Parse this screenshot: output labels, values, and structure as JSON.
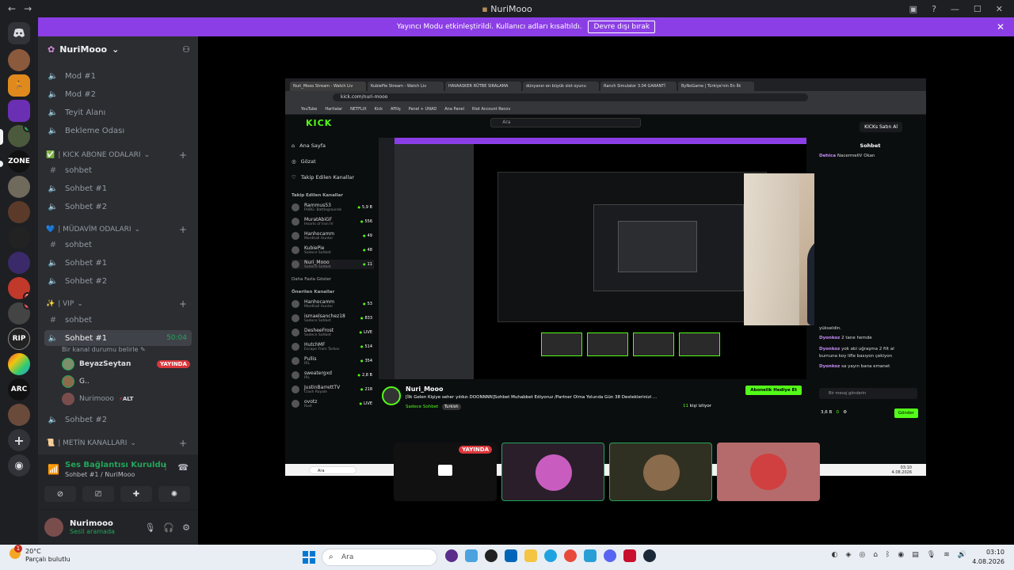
{
  "window": {
    "title": "NuriMooo",
    "back": "←",
    "forward": "→"
  },
  "banner": {
    "text": "Yayıncı Modu etkinleştirildi. Kullanıcı adları kısaltıldı.",
    "button": "Devre dışı bırak",
    "close": "✕"
  },
  "server": {
    "name": "NuriMooo",
    "chevron": "⌄"
  },
  "channels": {
    "mod1": "Mod #1",
    "mod2": "Mod #2",
    "teyit": "Teyit Alanı",
    "bekleme": "Bekleme Odası",
    "cat_kick": "| KICK ABONE ODALARI",
    "kick_sohbet": "sohbet",
    "kick_sohbet1": "Sohbet #1",
    "kick_sohbet2": "Sohbet #2",
    "cat_mudavim": "| MÜDAVİM ODALARI",
    "mud_sohbet": "sohbet",
    "mud_sohbet1": "Sohbet #1",
    "mud_sohbet2": "Sohbet #2",
    "cat_vip": "| VIP",
    "vip_sohbet": "sohbet",
    "vip_sohbet1": "Sohbet #1",
    "vip_timer": "50:04",
    "vip_status": "Bir kanal durumu belirle",
    "vip_sohbet2": "Sohbet #2",
    "cat_metin": "| METİN KANALLARI"
  },
  "members": [
    {
      "name": "BeyazSeytan",
      "badge": "YAYINDA"
    },
    {
      "name": "G..",
      "badge": ""
    },
    {
      "name": "Nurimooo",
      "badge": "ALT"
    }
  ],
  "voice": {
    "title": "Ses Bağlantısı Kuruldu",
    "sub": "Sohbet #1 / NuriMooo"
  },
  "user": {
    "name": "Nurimooo",
    "status": "Sesli aramada"
  },
  "stream": {
    "tabs": [
      "Nuri_Mooo Stream - Watch Liv",
      "KubiePie Stream - Watch Liv",
      "HAVAASKER RÜTBE SIRALAMA",
      "dünyanın en büyük slot oyunu",
      "Ranch Simulator 3.04 GARANTİ",
      "ByNoGame | Türkiye'nin En İlk"
    ],
    "url": "kick.com/nuri-mooo",
    "bookmarks": [
      "YouTube",
      "Haritalar",
      "NETFLIX",
      "Kick",
      "AFiliş",
      "Panel + UNAD",
      "Ana Panel",
      "Riot Account Recov"
    ],
    "logo": "KICK",
    "search": "Ara",
    "kick_button": "KICKs Satın Al",
    "side_top": [
      "Ana Sayfa",
      "Gözat",
      "Takip Edilen Kanallar"
    ],
    "followed_head": "Takip Edilen Kanallar",
    "followed": [
      {
        "name": "Rammus53",
        "sub": "PUBG: Battlegrounds",
        "count": "5,9 B"
      },
      {
        "name": "MuratAbiGF",
        "sub": "Hearts of Iron IV",
        "count": "556"
      },
      {
        "name": "Hanhocamm",
        "sub": "Mordhall Hunter",
        "count": "49"
      },
      {
        "name": "KubiePie",
        "sub": "Sadece Sohbet",
        "count": "48"
      },
      {
        "name": "Nuri_Mooo",
        "sub": "Sadece Sohbet",
        "count": "11"
      }
    ],
    "more": "Daha Fazla Göster",
    "recommended_head": "Önerilen Kanallar",
    "recommended": [
      {
        "name": "Hanhocamm",
        "sub": "Mordhall Hunter",
        "count": "53"
      },
      {
        "name": "ismaelsanchez18",
        "sub": "Sadece Sohbet",
        "count": "833"
      },
      {
        "name": "DesheeFrost",
        "sub": "Sadece Sohbet",
        "count": "LIVE"
      },
      {
        "name": "HutchMF",
        "sub": "Escape From Tarkov",
        "count": "514"
      },
      {
        "name": "Pullis",
        "sub": "IRL",
        "count": "354"
      },
      {
        "name": "sweatergxd",
        "sub": "IRL",
        "count": "2,8 B"
      },
      {
        "name": "JustinBarrettTV",
        "sub": "Clash Royale",
        "count": "218"
      },
      {
        "name": "ovotz",
        "sub": "Rust",
        "count": "LIVE"
      }
    ],
    "chat_title": "Sohbet",
    "chat_messages": [
      {
        "user": "Dehica",
        "text": "NacermeliV Okan"
      },
      {
        "user": "",
        "text": "yükseldin."
      },
      {
        "user": "Dyonkoz",
        "text": "2 tane hemde"
      },
      {
        "user": "Dyonkoz",
        "text": "yok abi uğraşma 2 filt al"
      },
      {
        "user": "",
        "text": "burnuna koy lifle basıyon çekiyon"
      },
      {
        "user": "Dyonkoz",
        "text": "sa yayın bana emanet"
      }
    ],
    "chat_placeholder": "Bir mesaj gönderin",
    "chat_send": "Gönder",
    "viewers_small": "3,6 B",
    "zero": "0",
    "streamer": "Nuri_Mooo",
    "stream_title": "[İlk Gelen Kişiye seher yıldızı DOONNNN]Sohbet Muhabbet Ediyoruz /Partner Olma Yolunda Gün 38 Desteklerinizi ...",
    "category": "Sadece Sohbet",
    "language": "Turkish",
    "subscribe": "Abonelik Hediye Et",
    "watching_count": "11",
    "watching_label": "kişi izliyor",
    "win_search": "Ara",
    "win_time": "03:10",
    "win_date": "4.08.2026"
  },
  "tiles": {
    "live": "YAYINDA"
  },
  "taskbar": {
    "temp": "20°C",
    "weather": "Parçalı bulutlu",
    "weather_badge": "1",
    "search": "Ara",
    "time": "03:10",
    "date": "4.08.2026"
  },
  "colors": {
    "accent_purple": "#8c3ee6",
    "kick_green": "#53fc18",
    "discord_green": "#23a55a",
    "live_red": "#da373c"
  }
}
